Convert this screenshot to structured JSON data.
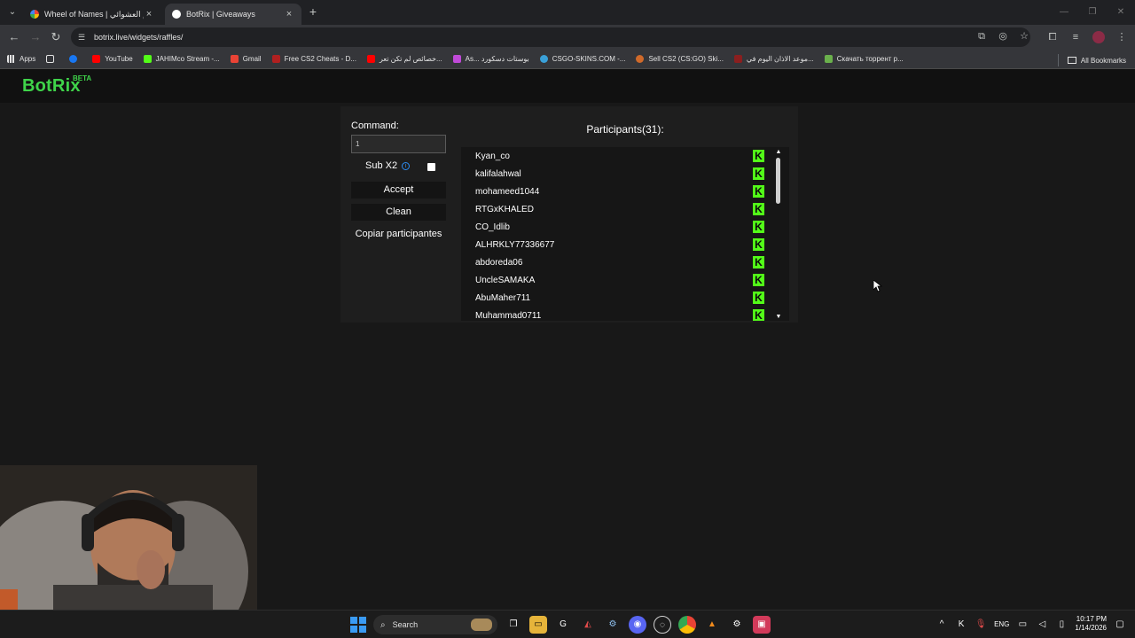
{
  "browser": {
    "tabs": [
      {
        "title": "Wheel of Names | سم العشوائي",
        "active": false
      },
      {
        "title": "BotRix | Giveaways",
        "active": true
      }
    ],
    "url": "botrix.live/widgets/raffles/",
    "bookmarks": [
      {
        "label": "Apps",
        "color": "#ffffff"
      },
      {
        "label": "",
        "color": "#1877f2"
      },
      {
        "label": "YouTube",
        "color": "#ff0000"
      },
      {
        "label": "JAHIMco Stream -...",
        "color": "#53fc18"
      },
      {
        "label": "Gmail",
        "color": "#ea4335"
      },
      {
        "label": "Free CS2 Cheats - D...",
        "color": "#b02020"
      },
      {
        "label": "خصائص لم تكن تعر...",
        "color": "#ff0000"
      },
      {
        "label": "As... بوستات دسكورد",
        "color": "#c04ad8"
      },
      {
        "label": "CSGO-SKINS.COM -...",
        "color": "#3aa0d8"
      },
      {
        "label": "Sell CS2 (CS:GO) Ski...",
        "color": "#d06a2a"
      },
      {
        "label": "موعد الاذان اليوم في...",
        "color": "#8b1f1f"
      },
      {
        "label": "Скачать торрент р...",
        "color": "#6ab04c"
      }
    ],
    "all_bookmarks": "All Bookmarks"
  },
  "app": {
    "logo": "BotRix",
    "logo_badge": "BETA"
  },
  "controls": {
    "command_label": "Command:",
    "command_value": "1",
    "sub_label": "Sub X2",
    "sub_checked": false,
    "accept": "Accept",
    "clean": "Clean",
    "copy": "Copiar participantes"
  },
  "participants": {
    "title": "Participants(31):",
    "names": [
      "Kyan_co",
      "kalifalahwal",
      "mohameed1044",
      "RTGxKHALED",
      "CO_Idlib",
      "ALHRKLY77336677",
      "abdoreda06",
      "UncleSAMAKA",
      "AbuMaher711",
      "Muhammad0711"
    ],
    "badge_letter": "K",
    "badge_color": "#53fc18"
  },
  "taskbar": {
    "search_placeholder": "Search",
    "language": "ENG",
    "time": "10:17 PM",
    "date": "1/14/2026"
  }
}
